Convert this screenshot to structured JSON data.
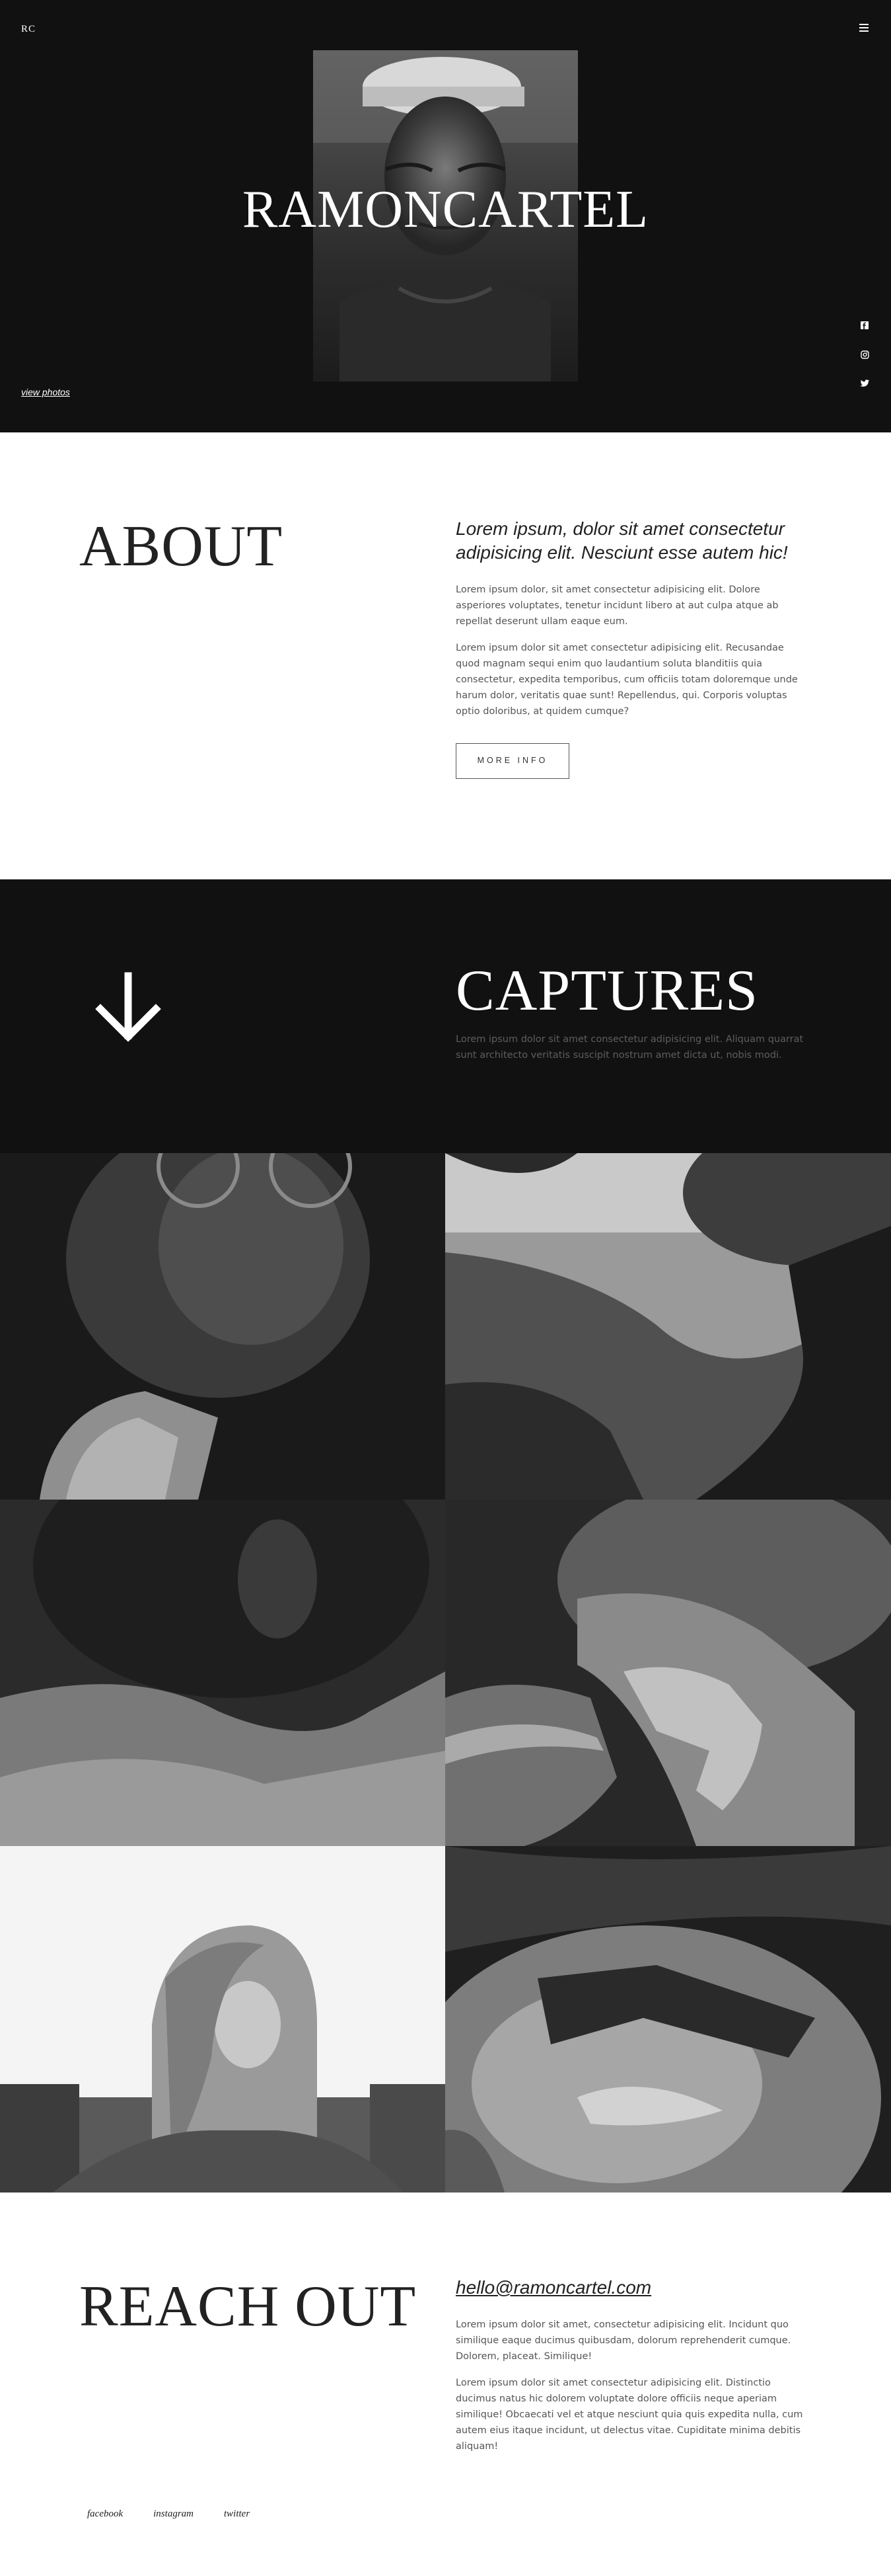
{
  "header": {
    "logo": "RC",
    "title": "RAMONCARTEL",
    "view_photos": "view photos",
    "menu_icon": "hamburger-menu-icon",
    "social_icons": [
      "facebook-icon",
      "instagram-icon",
      "twitter-icon"
    ]
  },
  "about": {
    "heading": "ABOUT",
    "lead": "Lorem ipsum, dolor sit amet consectetur adipisicing elit. Nesciunt esse autem hic!",
    "paragraph_1": "Lorem ipsum dolor, sit amet consectetur adipisicing elit. Dolore asperiores voluptates, tenetur incidunt libero at aut culpa atque ab repellat deserunt ullam eaque eum.",
    "paragraph_2": "Lorem ipsum dolor sit amet consectetur adipisicing elit. Recusandae quod magnam sequi enim quo laudantium soluta blanditiis quia consectetur, expedita temporibus, cum officiis totam doloremque unde harum dolor, veritatis quae sunt! Repellendus, qui. Corporis voluptas optio doloribus, at quidem cumque?",
    "button_label": "MORE INFO"
  },
  "captures": {
    "heading": "CAPTURES",
    "text": "Lorem ipsum dolor sit amet consectetur adipisicing elit. Aliquam quarrat sunt architecto veritatis suscipit nostrum amet dicta ut, nobis modi.",
    "arrow_icon": "arrow-down-icon"
  },
  "contact": {
    "heading": "REACH OUT",
    "email": "hello@ramoncartel.com",
    "paragraph_1": "Lorem ipsum dolor sit amet, consectetur adipisicing elit. Incidunt quo similique eaque ducimus quibusdam, dolorum reprehenderit cumque. Dolorem, placeat. Similique!",
    "paragraph_2": "Lorem ipsum dolor sit amet consectetur adipisicing elit. Distinctio ducimus natus hic dolorem voluptate dolore officiis neque aperiam similique! Obcaecati vel et atque nesciunt quia quis expedita nulla, cum autem eius itaque incidunt, ut delectus vitae. Cupiditate minima debitis aliquam!"
  },
  "footer": {
    "links": [
      "facebook",
      "instagram",
      "twitter"
    ]
  }
}
